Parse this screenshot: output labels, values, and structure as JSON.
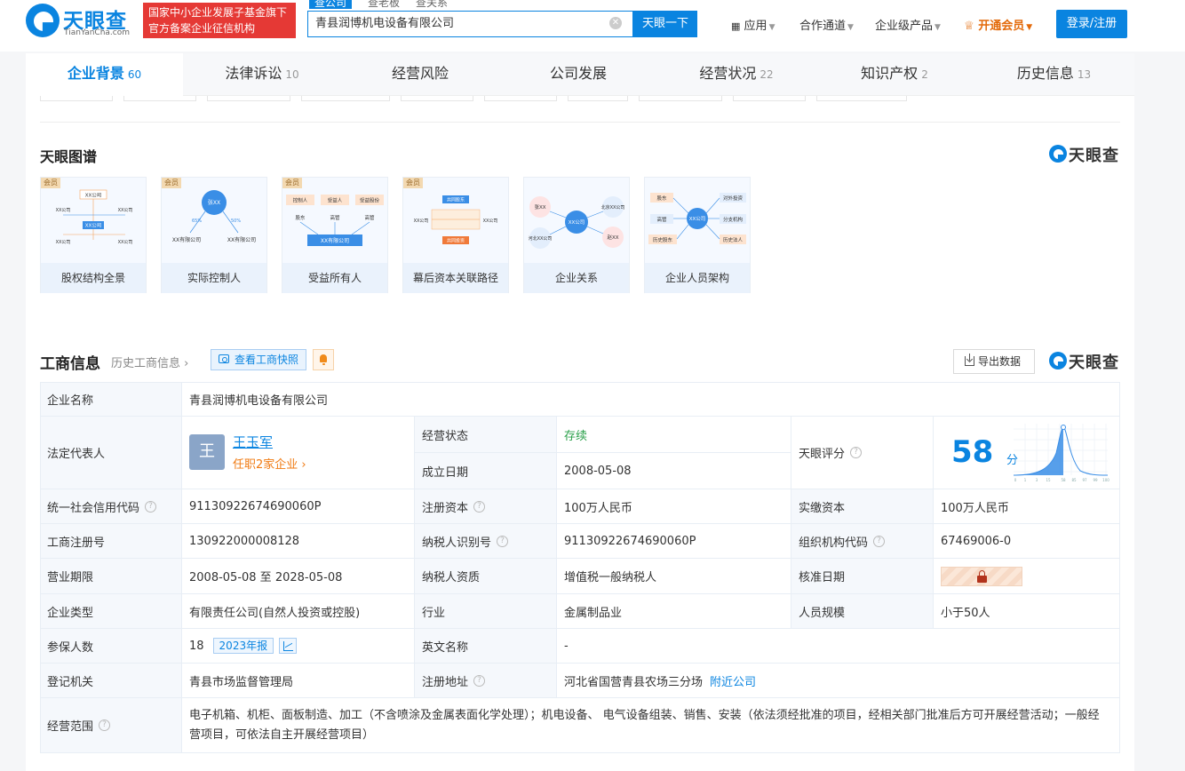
{
  "header": {
    "logo_cn": "天眼查",
    "logo_en": "TianYanCha.com",
    "gov_badge": [
      "国家中小企业发展子基金旗下",
      "官方备案企业征信机构"
    ],
    "search_tabs": [
      "查公司",
      "查老板",
      "查关系"
    ],
    "search_value": "青县润博机电设备有限公司",
    "search_button": "天眼一下",
    "nav": [
      "应用",
      "合作通道",
      "企业级产品"
    ],
    "vip": "开通会员",
    "login": "登录/注册"
  },
  "tabs": [
    {
      "label": "企业背景",
      "count": "60"
    },
    {
      "label": "法律诉讼",
      "count": "10"
    },
    {
      "label": "经营风险",
      "count": ""
    },
    {
      "label": "公司发展",
      "count": ""
    },
    {
      "label": "经营状况",
      "count": "22"
    },
    {
      "label": "知识产权",
      "count": "2"
    },
    {
      "label": "历史信息",
      "count": "13"
    }
  ],
  "graph_section": {
    "title": "天眼图谱",
    "brand": "天眼查",
    "vip_tag": "会员",
    "cards": [
      "股权结构全景",
      "实际控制人",
      "受益所有人",
      "幕后资本关联路径",
      "企业关系",
      "企业人员架构"
    ],
    "thumb": {
      "c1": [
        "XX公司",
        "XX公司",
        "XX公司",
        "XX公司",
        "XX公司",
        "XX公司"
      ],
      "c2": [
        "张XX",
        "XX有限公司",
        "XX有限公司",
        "65%",
        "50%"
      ],
      "c3": [
        "控制人",
        "受益人",
        "受益股份",
        "股东",
        "高管",
        "高管",
        "XX有限公司"
      ],
      "c4": [
        "共同股东",
        "XX公司",
        "XX公司",
        "共同投资"
      ],
      "c5": [
        "张XX",
        "XX公司",
        "北京XX公司",
        "河北XX公司",
        "赵XX"
      ],
      "c6": [
        "股东",
        "对外投资",
        "高管",
        "XX公司",
        "分支机构",
        "历史股东",
        "历史法人"
      ]
    }
  },
  "biz": {
    "title": "工商信息",
    "history_link": "历史工商信息",
    "snapshot": "查看工商快照",
    "export": "导出数据",
    "brand": "天眼查"
  },
  "table": {
    "company_name_label": "企业名称",
    "company_name": "青县润博机电设备有限公司",
    "legal_rep_label": "法定代表人",
    "legal_rep_avatar": "王",
    "legal_rep_name": "王玉军",
    "legal_rep_sub": "任职2家企业",
    "status_label": "经营状态",
    "status": "存续",
    "founded_label": "成立日期",
    "founded": "2008-05-08",
    "score_label": "天眼评分",
    "score": "58",
    "score_unit": "分",
    "score_axis": [
      "0",
      "1",
      "3",
      "15",
      "58",
      "85",
      "97",
      "99",
      "100"
    ],
    "credit_code_label": "统一社会信用代码",
    "credit_code": "91130922674690060P",
    "reg_capital_label": "注册资本",
    "reg_capital": "100万人民币",
    "paid_capital_label": "实缴资本",
    "paid_capital": "100万人民币",
    "reg_no_label": "工商注册号",
    "reg_no": "130922000008128",
    "taxpayer_id_label": "纳税人识别号",
    "taxpayer_id": "91130922674690060P",
    "org_code_label": "组织机构代码",
    "org_code": "67469006-0",
    "term_label": "营业期限",
    "term": "2008-05-08 至 2028-05-08",
    "tax_qual_label": "纳税人资质",
    "tax_qual": "增值税一般纳税人",
    "approve_label": "核准日期",
    "type_label": "企业类型",
    "type": "有限责任公司(自然人投资或控股)",
    "industry_label": "行业",
    "industry": "金属制品业",
    "staff_label": "人员规模",
    "staff": "小于50人",
    "insured_label": "参保人数",
    "insured": "18",
    "insured_year": "2023年报",
    "english_label": "英文名称",
    "english": "-",
    "authority_label": "登记机关",
    "authority": "青县市场监督管理局",
    "address_label": "注册地址",
    "address": "河北省国营青县农场三分场",
    "nearby": "附近公司",
    "scope_label": "经营范围",
    "scope": "电子机箱、机柜、面板制造、加工（不含喷涂及金属表面化学处理）；机电设备、 电气设备组装、销售、安装（依法须经批准的项目，经相关部门批准后方可开展经营活动；一般经营项目，可依法自主开展经营项目）"
  }
}
